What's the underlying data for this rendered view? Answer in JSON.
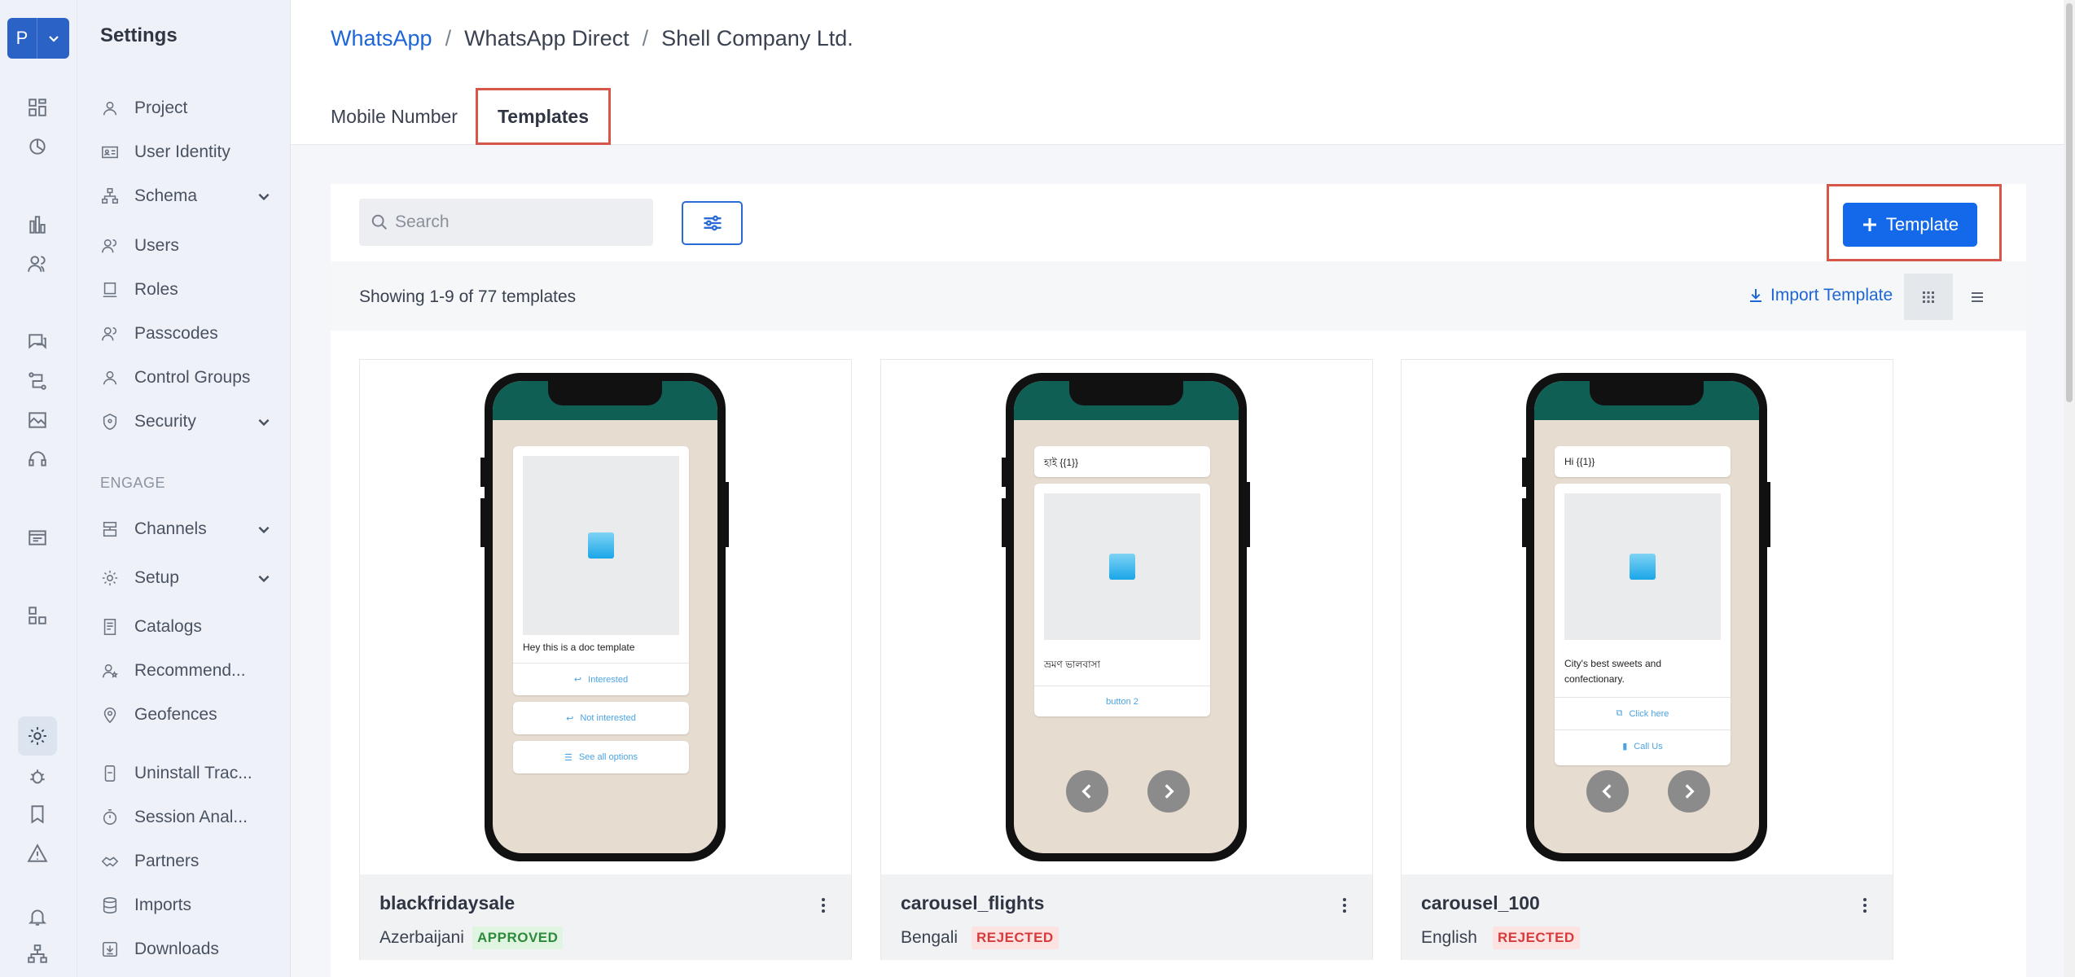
{
  "rail": {
    "project_initial": "P"
  },
  "sidebar": {
    "title": "Settings",
    "engage_label": "ENGAGE",
    "items": [
      {
        "label": "Project"
      },
      {
        "label": "User Identity"
      },
      {
        "label": "Schema"
      },
      {
        "label": "Users"
      },
      {
        "label": "Roles"
      },
      {
        "label": "Passcodes"
      },
      {
        "label": "Control Groups"
      },
      {
        "label": "Security"
      },
      {
        "label": "Channels"
      },
      {
        "label": "Setup"
      },
      {
        "label": "Catalogs"
      },
      {
        "label": "Recommend..."
      },
      {
        "label": "Geofences"
      },
      {
        "label": "Uninstall Trac..."
      },
      {
        "label": "Session Anal..."
      },
      {
        "label": "Partners"
      },
      {
        "label": "Imports"
      },
      {
        "label": "Downloads"
      }
    ]
  },
  "breadcrumb": {
    "root": "WhatsApp",
    "sep": "/",
    "middle": "WhatsApp Direct",
    "current": "Shell Company Ltd."
  },
  "tabs": {
    "mobile": "Mobile Number",
    "templates": "Templates"
  },
  "toolbar": {
    "search_placeholder": "Search",
    "add_label": "Template",
    "showing_text": "Showing 1-9 of 77 templates",
    "import_label": "Import Template"
  },
  "cards": [
    {
      "name": "blackfridaysale",
      "language": "Azerbaijani",
      "status": "APPROVED",
      "preview": {
        "body": "Hey this is a doc template",
        "buttons": [
          "Interested",
          "Not interested",
          "See all options"
        ]
      }
    },
    {
      "name": "carousel_flights",
      "language": "Bengali",
      "status": "REJECTED",
      "preview": {
        "header": "হাই {{1}}",
        "body": "ভ্রমণ ভালবাসা",
        "buttons": [
          "button 2"
        ]
      }
    },
    {
      "name": "carousel_100",
      "language": "English",
      "status": "REJECTED",
      "preview": {
        "header": "Hi {{1}}",
        "body": " City's best sweets and confectionary.",
        "buttons": [
          "Click here",
          "Call Us"
        ]
      }
    }
  ],
  "colors": {
    "primary": "#1469ea",
    "highlight_border": "#d6574a",
    "approved": "#2e8a3b",
    "rejected": "#d43b3b"
  }
}
